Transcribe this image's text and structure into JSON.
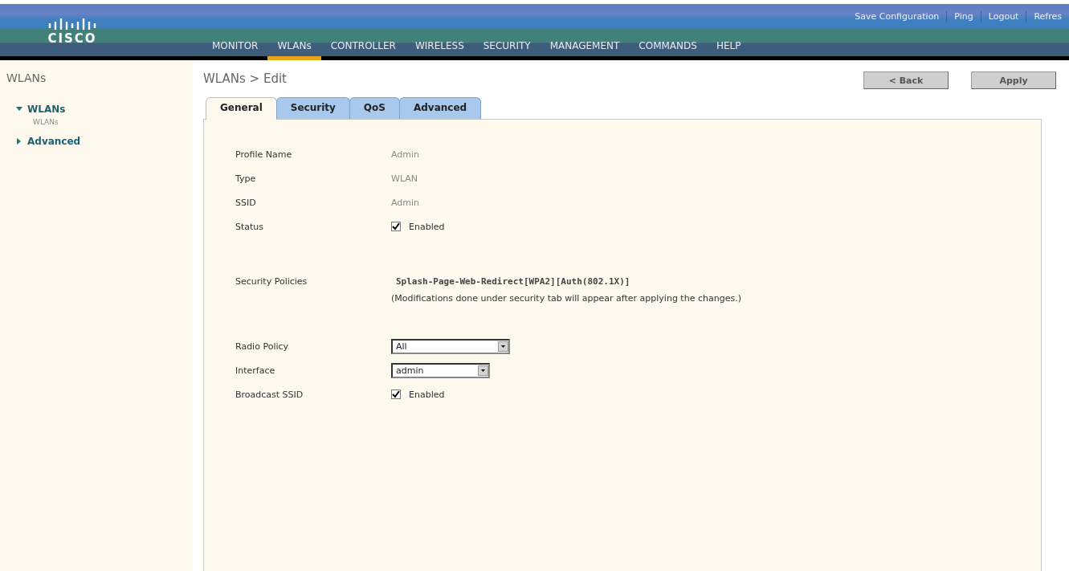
{
  "header": {
    "logo": "CISCO",
    "links": [
      "Save Configuration",
      "Ping",
      "Logout",
      "Refres"
    ],
    "nav": [
      {
        "label": "MONITOR",
        "selected": false
      },
      {
        "label": "WLANs",
        "selected": true
      },
      {
        "label": "CONTROLLER",
        "selected": false
      },
      {
        "label": "WIRELESS",
        "selected": false
      },
      {
        "label": "SECURITY",
        "selected": false
      },
      {
        "label": "MANAGEMENT",
        "selected": false
      },
      {
        "label": "COMMANDS",
        "selected": false
      },
      {
        "label": "HELP",
        "selected": false
      }
    ]
  },
  "sidebar": {
    "title": "WLANs",
    "items": [
      {
        "label": "WLANs",
        "expanded": true,
        "children": [
          {
            "label": "WLANs"
          }
        ]
      },
      {
        "label": "Advanced",
        "expanded": false
      }
    ]
  },
  "page": {
    "title": "WLANs > Edit",
    "buttons": [
      "< Back",
      "Apply"
    ],
    "tabs": [
      {
        "label": "General",
        "selected": true
      },
      {
        "label": "Security",
        "selected": false
      },
      {
        "label": "QoS",
        "selected": false
      },
      {
        "label": "Advanced",
        "selected": false
      }
    ],
    "groups": [
      [
        {
          "kind": "text",
          "label": "Profile Name",
          "value": "Admin"
        },
        {
          "kind": "text",
          "label": "Type",
          "value": "WLAN"
        },
        {
          "kind": "text",
          "label": "SSID",
          "value": "Admin"
        },
        {
          "kind": "checkbox",
          "label": "Status",
          "checked": true,
          "value": "Enabled"
        }
      ],
      [
        {
          "kind": "policy",
          "label": "Security Policies",
          "value": "Splash-Page-Web-Redirect[WPA2][Auth(802.1X)]",
          "note": "(Modifications done under security tab will appear after applying the changes.)"
        }
      ],
      [
        {
          "kind": "select",
          "label": "Radio Policy",
          "value": "All"
        },
        {
          "kind": "select",
          "label": "Interface",
          "value": "admin"
        },
        {
          "kind": "checkbox",
          "label": "Broadcast SSID",
          "checked": true,
          "value": "Enabled"
        }
      ]
    ]
  }
}
